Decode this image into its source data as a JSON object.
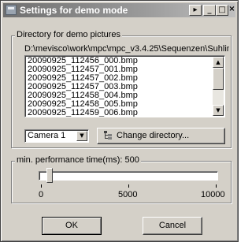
{
  "window": {
    "title": "Settings for demo mode",
    "buttons": [
      "▸",
      "_",
      "□",
      "×"
    ]
  },
  "directory_group": {
    "label": "Directory for demo pictures",
    "path": "D:\\mevisco\\work\\mpc\\mpc_v3.4.25\\Sequenzen\\Suhlin",
    "files": [
      "20090925_112456_000.bmp",
      "20090925_112457_001.bmp",
      "20090925_112457_002.bmp",
      "20090925_112457_003.bmp",
      "20090925_112458_004.bmp",
      "20090925_112458_005.bmp",
      "20090925_112459_006.bmp"
    ],
    "camera_select": "Camera 1",
    "change_dir_label": "Change directory..."
  },
  "performance_group": {
    "label": "min. performance time(ms): 500",
    "slider": {
      "min": 0,
      "max": 10000,
      "value": 500
    },
    "tick_labels": [
      "0",
      "5000",
      "10000"
    ]
  },
  "buttons": {
    "ok": "OK",
    "cancel": "Cancel"
  }
}
